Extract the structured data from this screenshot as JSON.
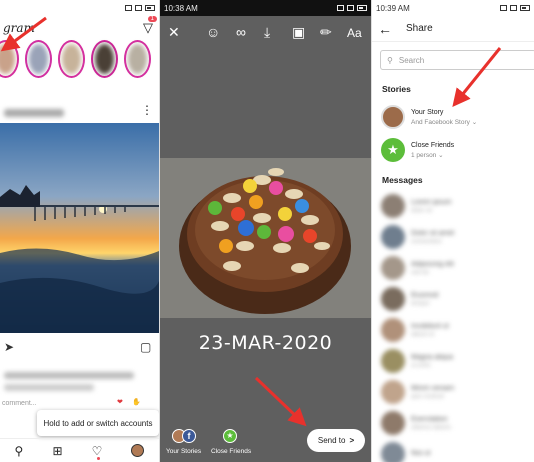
{
  "feed": {
    "status_time": "",
    "logo_text": "gram",
    "dm_badge": "1",
    "post_user": "",
    "comment_placeholder": "comment...",
    "tooltip": "Hold to add or switch accounts"
  },
  "story_editor": {
    "status_time": "10:38 AM",
    "date_text": "23-MAR-2020",
    "your_stories_label": "Your Stories",
    "close_friends_label": "Close Friends",
    "send_to_label": "Send to",
    "send_to_chevron": ">"
  },
  "share": {
    "status_time": "10:39 AM",
    "title": "Share",
    "search_placeholder": "Search",
    "stories_header": "Stories",
    "your_story": {
      "name": "Your Story",
      "sub": "And Facebook Story ⌄"
    },
    "close_friends": {
      "name": "Close Friends",
      "sub": "1 person ⌄"
    },
    "messages_header": "Messages",
    "messages": [
      {
        "name": "Lorem ipsum",
        "sub": "dolor sit"
      },
      {
        "name": "Dolor sit amet",
        "sub": "consectetur"
      },
      {
        "name": "Adipiscing elit",
        "sub": "sed do"
      },
      {
        "name": "Eiusmod",
        "sub": "tempor"
      },
      {
        "name": "Incididunt ut",
        "sub": "labore et"
      },
      {
        "name": "Magna aliqua",
        "sub": "ut enim"
      },
      {
        "name": "Minim veniam",
        "sub": "quis nostrud"
      },
      {
        "name": "Exercitation",
        "sub": "ullamco laboris"
      },
      {
        "name": "Nisi ut",
        "sub": ""
      }
    ]
  },
  "colors": {
    "accent_red": "#e8312c",
    "ig_badge": "#ed4956",
    "close_friends_green": "#5cbd3a",
    "story_ring": "#d6249f"
  }
}
